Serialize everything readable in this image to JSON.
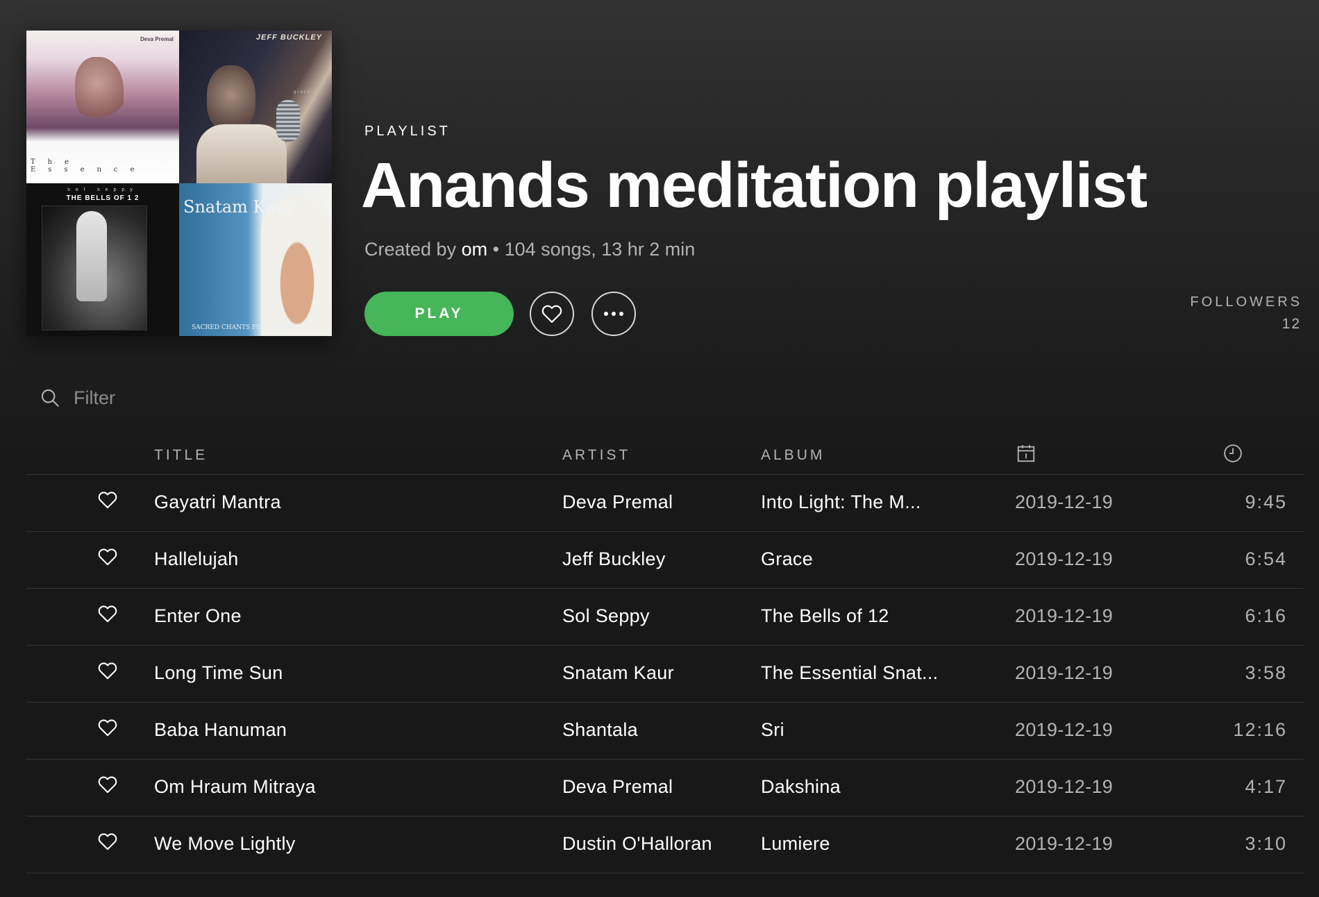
{
  "playlist": {
    "kicker": "PLAYLIST",
    "title": "Anands meditation playlist",
    "created_by_label": "Created by",
    "owner": "om",
    "separator": "•",
    "stats": "104 songs, 13 hr 2 min",
    "play_label": "PLAY",
    "followers_label": "FOLLOWERS",
    "followers_count": "12",
    "accent_color": "#47b55a"
  },
  "cover": {
    "tiles": [
      {
        "artist": "Deva Premal",
        "word": "The Essence"
      },
      {
        "artist": "JEFF BUCKLEY",
        "word": "grace"
      },
      {
        "top": "sol seppy",
        "word": "THE BELLS OF 1 2"
      },
      {
        "artist": "Snatam Kaur",
        "word": "SACRED CHANTS FOR HEALING"
      }
    ]
  },
  "filter": {
    "placeholder": "Filter"
  },
  "table": {
    "headers": {
      "title": "TITLE",
      "artist": "ARTIST",
      "album": "ALBUM",
      "date_icon": "calendar-icon",
      "duration_icon": "clock-icon"
    },
    "rows": [
      {
        "title": "Gayatri Mantra",
        "artist": "Deva Premal",
        "album": "Into Light: The M...",
        "date": "2019-12-19",
        "duration": "9:45"
      },
      {
        "title": "Hallelujah",
        "artist": "Jeff Buckley",
        "album": "Grace",
        "date": "2019-12-19",
        "duration": "6:54"
      },
      {
        "title": "Enter One",
        "artist": "Sol Seppy",
        "album": "The Bells of 12",
        "date": "2019-12-19",
        "duration": "6:16"
      },
      {
        "title": "Long Time Sun",
        "artist": "Snatam Kaur",
        "album": "The Essential Snat...",
        "date": "2019-12-19",
        "duration": "3:58"
      },
      {
        "title": "Baba Hanuman",
        "artist": "Shantala",
        "album": "Sri",
        "date": "2019-12-19",
        "duration": "12:16"
      },
      {
        "title": "Om Hraum Mitraya",
        "artist": "Deva Premal",
        "album": "Dakshina",
        "date": "2019-12-19",
        "duration": "4:17"
      },
      {
        "title": "We Move Lightly",
        "artist": "Dustin O'Halloran",
        "album": "Lumiere",
        "date": "2019-12-19",
        "duration": "3:10"
      }
    ]
  }
}
